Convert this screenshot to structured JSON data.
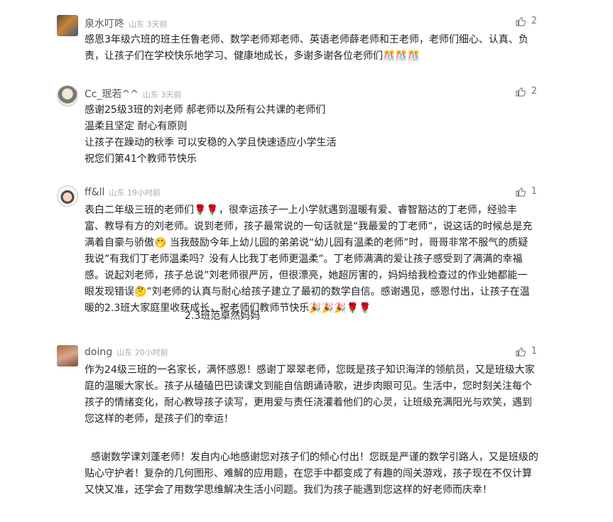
{
  "comments": [
    {
      "user": "泉水叮咚",
      "location": "山东",
      "time": "3天前",
      "likes": "2",
      "text": "感恩3年级六班的班主任鲁老师、数学老师郑老师、英语老师薛老师和王老师，老师们细心、认真、负责，让孩子们在学校快乐地学习、健康地成长，多谢多谢各位老师们🎊🎊🎊"
    },
    {
      "user": "Cc_珉若^^",
      "location": "山东",
      "time": "3天前",
      "likes": "2",
      "text": "感谢25级3班的刘老师 郝老师以及所有公共课的老师们\n温柔且坚定 耐心有原则\n让孩子在躁动的秋季 可以安稳的入学且快速适应小学生活\n祝您们第41个教师节快乐"
    },
    {
      "user": "ff&ll",
      "location": "山东",
      "time": "19小时前",
      "likes": "1",
      "text": "表白二年级三班的老师们🌹🌹，很幸运孩子一上小学就遇到温暖有爱、睿智豁达的丁老师，经验丰富、教导有方的刘老师。说到老师，孩子最常说的一句话就是“我最爱的丁老师”，说这话的时候总是充满着自豪与骄傲🤭 当我鼓励今年上幼儿园的弟弟说“幼儿园有温柔的老师”时，哥哥非常不服气的质疑我说”有我们丁老师温柔吗？没有人比我丁老师更温柔”。丁老师满满的爱让孩子感受到了满满的幸福感。说起刘老师，孩子总说”刘老师很严厉，但很漂亮，她超厉害的，妈妈给我检查过的作业她都能一眼发现错误🤔”刘老师的认真与耐心给孩子建立了最初的数学自信。感谢遇见，感恩付出，让孩子在温暖的2.3班大家庭里收获成长，祝老师们教师节快乐🎉🎉🎉🌹🌹",
      "signature": "2.3班范卓然妈妈"
    },
    {
      "user": "doing",
      "location": "山东",
      "time": "20小时前",
      "likes": "1",
      "text": "作为24级三班的一名家长，满怀感恩！感谢丁翠翠老师，您既是孩子知识海洋的领航员，又是班级大家庭的温暖大家长。孩子从磕磕巴巴读课文到能自信朗诵诗歌，进步肉眼可见。生活中，您时刻关注每个孩子的情绪变化，耐心教导孩子读写，更用爱与责任浇灌着他们的心灵，让班级充满阳光与欢笑，遇到您这样的老师，是孩子们的幸运！"
    }
  ],
  "footer_text": "  感谢数学课刘蓬老师！发自内心地感谢您对孩子们的倾心付出！您既是严谨的数学引路人，又是班级的贴心守护者！复杂的几何图形、难解的应用题，在您手中都变成了有趣的闯关游戏，孩子现在不仅计算又快又准，还学会了用数学思维解决生活小问题。我们为孩子能遇到您这样的好老师而庆幸！",
  "icons": {
    "like": "thumbs-up-icon"
  }
}
